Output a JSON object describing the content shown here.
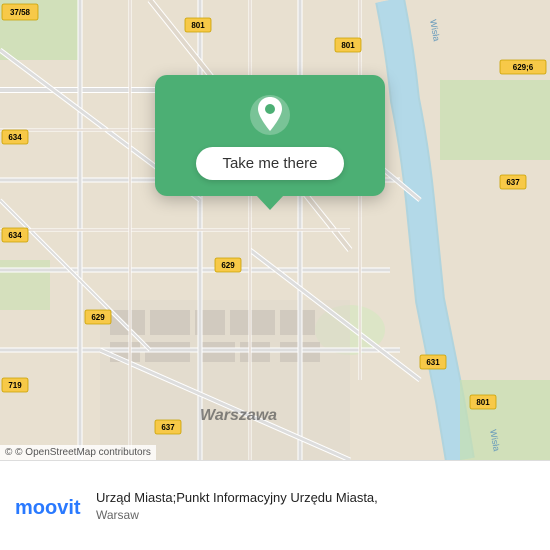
{
  "map": {
    "popup": {
      "button_label": "Take me there"
    },
    "attribution": "© OpenStreetMap contributors"
  },
  "place": {
    "name": "Urząd Miasta;Punkt Informacyjny Urzędu Miasta,",
    "city": "Warsaw"
  },
  "logo": {
    "text": "moovit",
    "color": "#2979ff"
  },
  "road_badges": [
    "37/58",
    "801",
    "801",
    "637",
    "634",
    "629",
    "634",
    "629",
    "719",
    "637",
    "631",
    "801"
  ]
}
